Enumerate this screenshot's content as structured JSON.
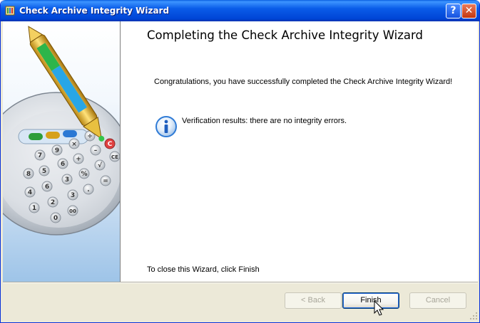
{
  "window": {
    "title": "Check Archive Integrity Wizard",
    "help_label": "?",
    "close_label": "✕"
  },
  "main": {
    "heading": "Completing the Check Archive Integrity Wizard",
    "congratulations": "Congratulations, you have successfully completed the Check Archive Integrity Wizard!",
    "verification_result": "Verification results: there are no integrity errors.",
    "close_instruction": "To close this Wizard, click Finish"
  },
  "buttons": {
    "back": "< Back",
    "finish": "Finish",
    "cancel": "Cancel",
    "back_enabled": false,
    "cancel_enabled": false
  },
  "side_image": {
    "description_icon": "calculator-pen-illustration",
    "calc_keys": [
      "÷",
      "×",
      "8",
      "9",
      "C",
      "CE",
      "7",
      "6",
      "+",
      "–",
      "4",
      "5",
      "3",
      "%",
      "√",
      "=",
      "1",
      "2",
      "00",
      ".",
      "0"
    ]
  },
  "icons": {
    "app": "wizard-app-icon",
    "info": "info-icon",
    "cursor": "mouse-pointer-icon",
    "grip": "resize-grip-icon"
  },
  "colors": {
    "titlebar": "#0a5ce8",
    "face": "#ece9d8",
    "info_blue": "#2f7bd6"
  }
}
